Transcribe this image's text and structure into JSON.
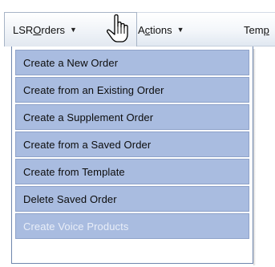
{
  "menubar": {
    "orders": {
      "pre": "LSR ",
      "accel": "O",
      "post": "rders"
    },
    "actions": {
      "pre": "A",
      "accel": "c",
      "post": "tions"
    },
    "templates": {
      "pre": "Tem",
      "accel": "p",
      "post": ""
    }
  },
  "dropdown": {
    "items": [
      {
        "label": "Create a New Order",
        "enabled": true
      },
      {
        "label": "Create from an Existing Order",
        "enabled": true
      },
      {
        "label": "Create a Supplement Order",
        "enabled": true
      },
      {
        "label": "Create from a Saved Order",
        "enabled": true
      },
      {
        "label": "Create from Template",
        "enabled": true
      },
      {
        "label": "Delete Saved Order",
        "enabled": true
      },
      {
        "label": "Create Voice Products",
        "enabled": false
      }
    ]
  },
  "colors": {
    "item_bg": "#a9bce0",
    "item_border": "#8ea2c9",
    "dropdown_border": "#6f86ad",
    "disabled_text": "#e9eef8"
  },
  "icons": {
    "caret": "caret-down-icon",
    "cursor": "hand-pointer-icon"
  }
}
